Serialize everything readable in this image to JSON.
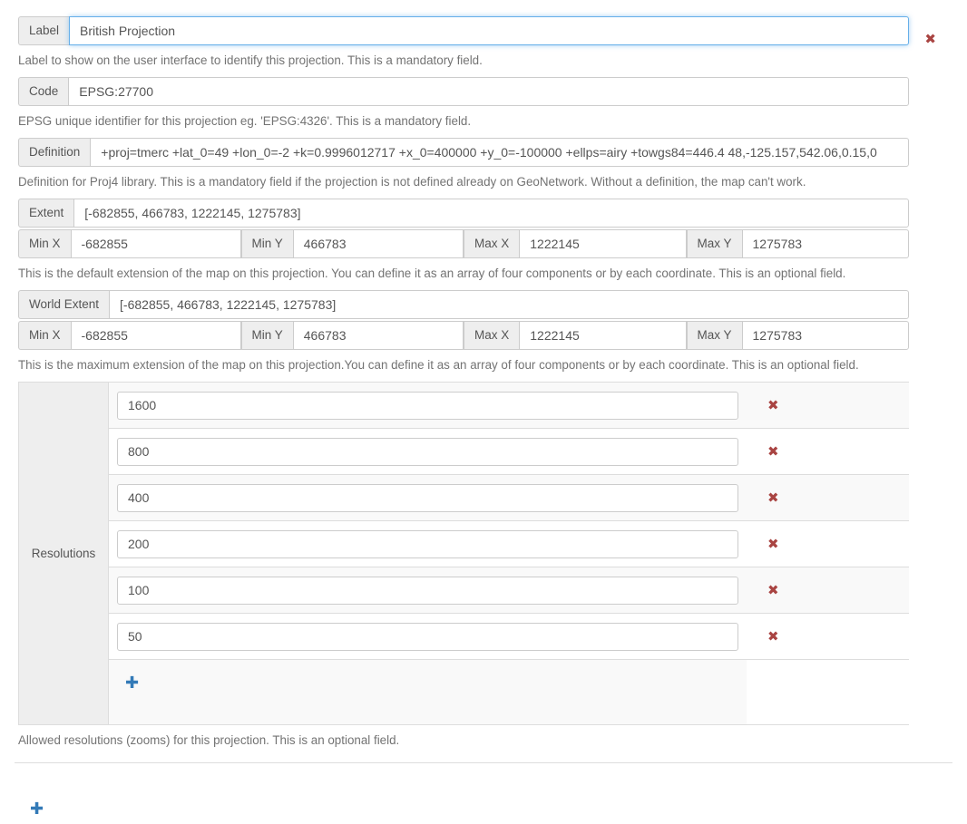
{
  "form": {
    "fields": [
      {
        "label": "Label",
        "value": "British Projection",
        "help": "Label to show on the user interface to identify this projection. This is a mandatory field.",
        "focused": true
      },
      {
        "label": "Code",
        "value": "EPSG:27700",
        "help": "EPSG unique identifier for this projection eg. 'EPSG:4326'. This is a mandatory field.",
        "focused": false
      },
      {
        "label": "Definition",
        "value": "+proj=tmerc +lat_0=49 +lon_0=-2 +k=0.9996012717 +x_0=400000 +y_0=-100000 +ellps=airy +towgs84=446.4 48,-125.157,542.06,0.15,0",
        "help": "Definition for Proj4 library. This is a mandatory field if the projection is not defined already on GeoNetwork. Without a definition, the map can't work.",
        "focused": false
      }
    ],
    "extent": {
      "label": "Extent",
      "value": "[-682855, 466783, 1222145, 1275783]",
      "help": "This is the default extension of the map on this projection. You can define it as an array of four components or by each coordinate. This is an optional field.",
      "coords": [
        {
          "label": "Min X",
          "value": "-682855"
        },
        {
          "label": "Min Y",
          "value": "466783"
        },
        {
          "label": "Max X",
          "value": "1222145"
        },
        {
          "label": "Max Y",
          "value": "1275783"
        }
      ]
    },
    "world_extent": {
      "label": "World Extent",
      "value": "[-682855, 466783, 1222145, 1275783]",
      "help": "This is the maximum extension of the map on this projection.You can define it as an array of four components or by each coordinate. This is an optional field.",
      "coords": [
        {
          "label": "Min X",
          "value": "-682855"
        },
        {
          "label": "Min Y",
          "value": "466783"
        },
        {
          "label": "Max X",
          "value": "1222145"
        },
        {
          "label": "Max Y",
          "value": "1275783"
        }
      ]
    },
    "resolutions": {
      "label": "Resolutions",
      "values": [
        "1600",
        "800",
        "400",
        "200",
        "100",
        "50"
      ],
      "help": "Allowed resolutions (zooms) for this projection. This is an optional field.",
      "add_icon": "plus-icon",
      "remove_icon": "remove-icon"
    },
    "remove_projection_icon": "remove-icon",
    "add_projection_icon": "plus-icon"
  },
  "icons": {
    "remove": "✖",
    "plus": "✚"
  },
  "colors": {
    "remove": "#a94442",
    "add": "#337ab7",
    "focus_border": "#66afe9",
    "addon_bg": "#eeeeee",
    "border": "#cccccc"
  }
}
